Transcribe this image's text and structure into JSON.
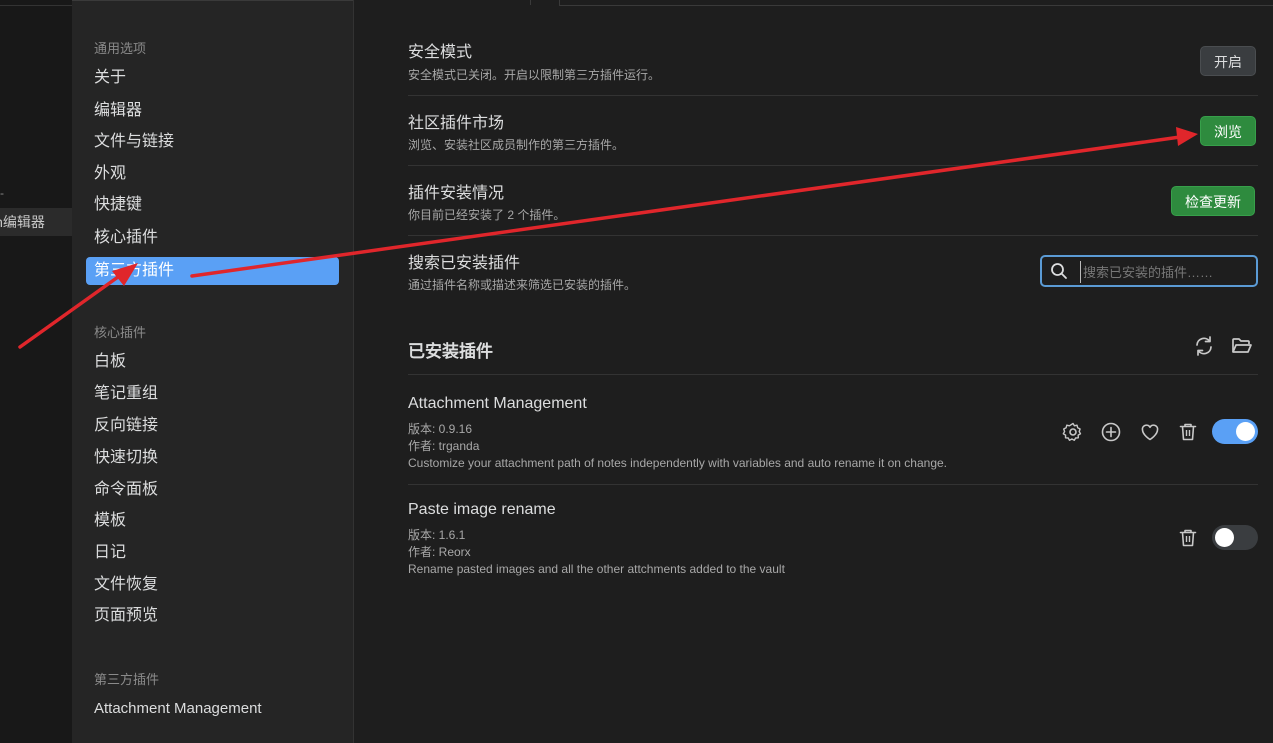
{
  "left_strip": {
    "dash": "-",
    "active_tab": "in编辑器"
  },
  "sidebar": {
    "general_heading": "通用选项",
    "general_items": [
      "关于",
      "编辑器",
      "文件与链接",
      "外观",
      "快捷键",
      "核心插件",
      "第三方插件"
    ],
    "active_item": "第三方插件",
    "core_heading": "核心插件",
    "core_items": [
      "白板",
      "笔记重组",
      "反向链接",
      "快速切换",
      "命令面板",
      "模板",
      "日记",
      "文件恢复",
      "页面预览"
    ],
    "community_heading": "第三方插件",
    "community_items": [
      "Attachment Management"
    ]
  },
  "settings": [
    {
      "name": "安全模式",
      "desc": "安全模式已关闭。开启以限制第三方插件运行。",
      "button": "开启",
      "style": "gray"
    },
    {
      "name": "社区插件市场",
      "desc": "浏览、安装社区成员制作的第三方插件。",
      "button": "浏览",
      "style": "green"
    },
    {
      "name": "插件安装情况",
      "desc": "你目前已经安装了 2 个插件。",
      "button": "检查更新",
      "style": "green"
    },
    {
      "name": "搜索已安装插件",
      "desc": "通过插件名称或描述来筛选已安装的插件。"
    }
  ],
  "search": {
    "placeholder": "搜索已安装的插件……"
  },
  "installed": {
    "title": "已安装插件",
    "icons": [
      "reload-icon",
      "folder-open-icon"
    ],
    "plugins": [
      {
        "name": "Attachment Management",
        "version": "版本: 0.9.16",
        "author": "作者:  trganda",
        "description": "Customize your attachment path of notes independently with variables and auto rename it on change.",
        "enabled": true,
        "icons": [
          "gear-icon",
          "plus-circle-icon",
          "heart-icon",
          "trash-icon"
        ]
      },
      {
        "name": "Paste image rename",
        "version": "版本: 1.6.1",
        "author": "作者:  Reorx",
        "description": "Rename pasted images and all the other attchments added to the vault",
        "enabled": false,
        "icons": [
          "trash-icon"
        ]
      }
    ]
  },
  "colors": {
    "accent": "#5aa0f5",
    "green_button": "#2e8b3e",
    "annotation_arrow": "#e0262b"
  }
}
